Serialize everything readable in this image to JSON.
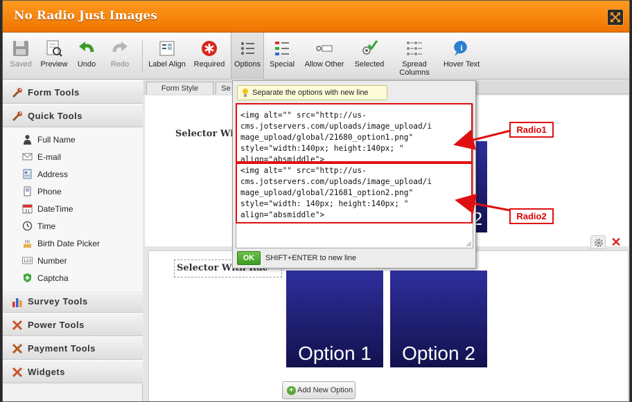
{
  "window": {
    "title": "No Radio Just Images"
  },
  "toolbar": {
    "items": [
      {
        "label": "Saved",
        "icon": "save-icon",
        "disabled": true
      },
      {
        "label": "Preview",
        "icon": "preview-icon"
      },
      {
        "label": "Undo",
        "icon": "undo-icon"
      },
      {
        "label": "Redo",
        "icon": "redo-icon",
        "disabled": true
      },
      {
        "label": "Label Align",
        "icon": "label-align-icon"
      },
      {
        "label": "Required",
        "icon": "required-icon"
      },
      {
        "label": "Options",
        "icon": "options-icon",
        "active": true
      },
      {
        "label": "Special",
        "icon": "special-icon"
      },
      {
        "label": "Allow Other",
        "icon": "allow-other-icon"
      },
      {
        "label": "Selected",
        "icon": "selected-icon"
      },
      {
        "label": "Spread Columns",
        "icon": "spread-columns-icon"
      },
      {
        "label": "Hover Text",
        "icon": "hover-text-icon"
      }
    ]
  },
  "sidebar": {
    "categories": [
      {
        "label": "Form Tools",
        "icon": "wrench-icon"
      },
      {
        "label": "Quick Tools",
        "icon": "wrench-icon"
      },
      {
        "label": "Survey Tools",
        "icon": "bar-chart-icon"
      },
      {
        "label": "Power Tools",
        "icon": "tools-icon"
      },
      {
        "label": "Payment Tools",
        "icon": "payment-icon"
      },
      {
        "label": "Widgets",
        "icon": "widgets-icon"
      }
    ],
    "quick_tools": [
      {
        "label": "Full Name",
        "icon": "person-icon"
      },
      {
        "label": "E-mail",
        "icon": "envelope-icon"
      },
      {
        "label": "Address",
        "icon": "address-icon"
      },
      {
        "label": "Phone",
        "icon": "phone-icon"
      },
      {
        "label": "DateTime",
        "icon": "calendar-icon"
      },
      {
        "label": "Time",
        "icon": "clock-icon"
      },
      {
        "label": "Birth Date Picker",
        "icon": "cake-icon"
      },
      {
        "label": "Number",
        "icon": "number-icon"
      },
      {
        "label": "Captcha",
        "icon": "shield-icon"
      }
    ]
  },
  "main": {
    "tabs": [
      "Form Style",
      "Se"
    ],
    "field_label": "Selector With Radio",
    "field_label_partial": "Selector With",
    "option_images": [
      "Option 1",
      "Option 2"
    ],
    "partial_option_text": "2",
    "add_option_label": "Add New Option"
  },
  "popup": {
    "hint": "Separate the options with new line",
    "textarea_lines": [
      "<img alt=\"\" src=\"http://us-",
      "cms.jotservers.com/uploads/image_upload/i",
      "mage_upload/global/21680_option1.png\"",
      "style=\"width:140px; height:140px; \"",
      "align=\"absmiddle\">",
      "<img alt=\"\" src=\"http://us-",
      "cms.jotservers.com/uploads/image_upload/i",
      "mage_upload/global/21681_option2.png\"",
      "style=\"width: 140px; height:140px; \"",
      "align=\"absmiddle\">"
    ],
    "ok_label": "OK",
    "ok_hint": "SHIFT+ENTER to new line"
  },
  "annotations": {
    "radio1": "Radio1",
    "radio2": "Radio2"
  },
  "colors": {
    "title_bar": "#f08200",
    "ok_button": "#4ea82c",
    "annotation_red": "#e01010",
    "option_image": "#1a1a70"
  }
}
